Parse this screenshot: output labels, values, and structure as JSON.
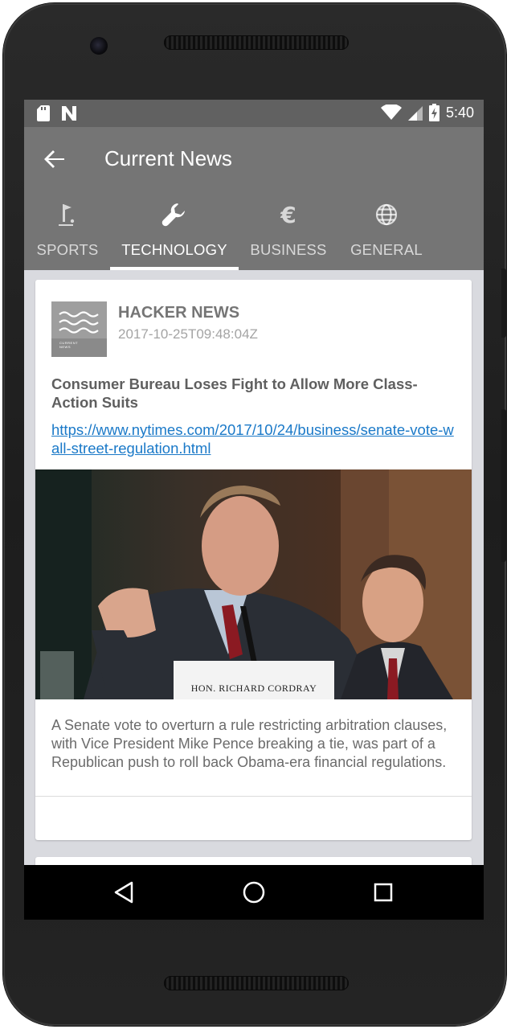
{
  "status_bar": {
    "time": "5:40",
    "left_icons": [
      "sd-card-icon",
      "n-icon"
    ],
    "right_icons": [
      "wifi-icon",
      "signal-icon",
      "battery-charging-icon"
    ]
  },
  "app_bar": {
    "title": "Current News",
    "back_icon": "arrow-left-icon"
  },
  "tabs": [
    {
      "label": "SPORTS",
      "icon": "golf-icon",
      "active": false
    },
    {
      "label": "TECHNOLOGY",
      "icon": "wrench-icon",
      "active": true
    },
    {
      "label": "BUSINESS",
      "icon": "euro-icon",
      "active": false
    },
    {
      "label": "GENERAL",
      "icon": "globe-icon",
      "active": false
    }
  ],
  "article": {
    "source": "HACKER NEWS",
    "date": "2017-10-25T09:48:04Z",
    "logo_caption": "CURRENT NEWS",
    "headline": "Consumer Bureau Loses Fight to Allow More Class-Action Suits",
    "url": "https://www.nytimes.com/2017/10/24/business/senate-vote-wall-street-regulation.html",
    "image_placard": "HON. RICHARD CORDRAY",
    "description": "A Senate vote to overturn a rule restricting arbitration clauses, with Vice President Mike Pence breaking a tie, was part of a Republican push to roll back Obama-era financial regulations."
  },
  "nav_bar": [
    "back-triangle-icon",
    "home-circle-icon",
    "recents-square-icon"
  ],
  "colors": {
    "status_bar": "#616161",
    "app_bar": "#757575",
    "background": "#d9dadf",
    "link": "#1a79c8"
  }
}
